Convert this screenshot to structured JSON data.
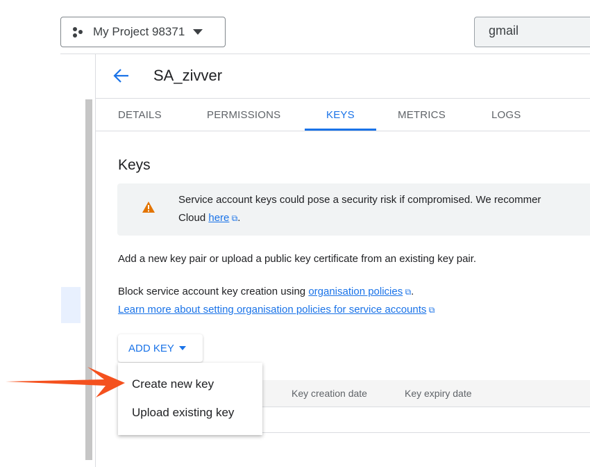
{
  "topbar": {
    "project_name": "My Project 98371",
    "search_value": "gmail"
  },
  "header": {
    "title": "SA_zivver"
  },
  "tabs": [
    {
      "label": "DETAILS"
    },
    {
      "label": "PERMISSIONS"
    },
    {
      "label": "KEYS",
      "active": true
    },
    {
      "label": "METRICS"
    },
    {
      "label": "LOGS"
    }
  ],
  "keys": {
    "heading": "Keys",
    "warning_line1": "Service account keys could pose a security risk if compromised. We recommer",
    "warning_line2_prefix": "Cloud ",
    "warning_link": "here",
    "warning_suffix": ".",
    "add_text": "Add a new key pair or upload a public key certificate from an existing key pair.",
    "block_prefix": "Block service account key creation using ",
    "block_link": "organisation policies",
    "block_suffix": ".",
    "learn_more": "Learn more about setting organisation policies for service accounts",
    "add_key_label": "ADD KEY",
    "columns": [
      "Key creation date",
      "Key expiry date"
    ],
    "menu": [
      "Create new key",
      "Upload existing key"
    ]
  },
  "colors": {
    "accent": "#1a73e8",
    "warning": "#e37400",
    "arrow": "#f4511e"
  }
}
